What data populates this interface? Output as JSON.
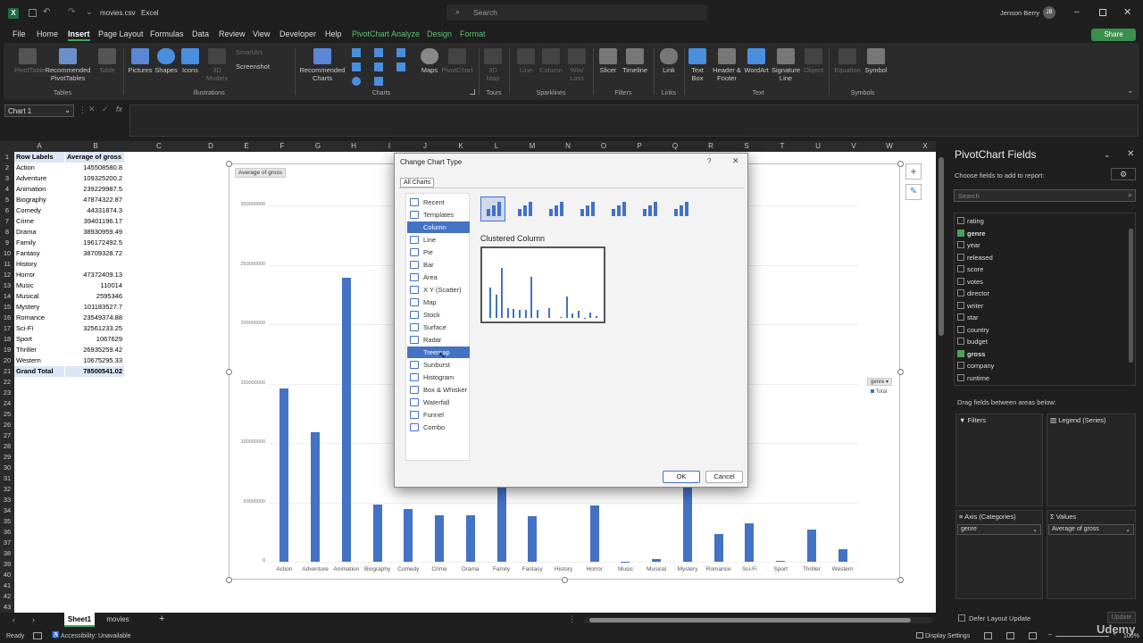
{
  "titlebar": {
    "filename": "movies.csv",
    "app": "Excel",
    "search_placeholder": "Search",
    "user": "Jenson Berry",
    "user_initials": "JB"
  },
  "menu": {
    "tabs": [
      "File",
      "Home",
      "Insert",
      "Page Layout",
      "Formulas",
      "Data",
      "Review",
      "View",
      "Developer",
      "Help"
    ],
    "ctx_tabs": [
      "PivotChart Analyze",
      "Design",
      "Format"
    ],
    "share": "Share"
  },
  "ribbon": {
    "groups": [
      "Tables",
      "Illustrations",
      "Charts",
      "Tours",
      "Sparklines",
      "Filters",
      "Links",
      "Text",
      "Symbols"
    ],
    "buttons": {
      "pivottable": "PivotTable",
      "recommended_pivot": "Recommended PivotTables",
      "table": "Table",
      "pictures": "Pictures",
      "shapes": "Shapes",
      "icons": "Icons",
      "models": "3D Models",
      "smartart": "SmartArt",
      "screenshot": "Screenshot",
      "recommended_charts": "Recommended Charts",
      "maps": "Maps",
      "pivotchart": "PivotChart",
      "map3d": "3D Map",
      "line": "Line",
      "column": "Column",
      "winloss": "Win/ Loss",
      "slicer": "Slicer",
      "timeline": "Timeline",
      "link": "Link",
      "textbox": "Text Box",
      "headerfooter": "Header & Footer",
      "wordart": "WordArt",
      "signature": "Signature Line",
      "object": "Object",
      "equation": "Equation",
      "symbol": "Symbol"
    }
  },
  "namebox": "Chart 1",
  "columns": [
    "A",
    "B",
    "C",
    "D",
    "E",
    "F",
    "G",
    "H",
    "I",
    "J",
    "K",
    "L",
    "M",
    "N",
    "O",
    "P",
    "Q",
    "R",
    "S",
    "T",
    "U",
    "V",
    "W",
    "X"
  ],
  "table": {
    "header": [
      "Row Labels",
      "Average of gross"
    ],
    "rows": [
      [
        "Action",
        "145508580.8"
      ],
      [
        "Adventure",
        "109325200.2"
      ],
      [
        "Animation",
        "239229987.5"
      ],
      [
        "Biography",
        "47874322.87"
      ],
      [
        "Comedy",
        "44331874.3"
      ],
      [
        "Crime",
        "39401196.17"
      ],
      [
        "Drama",
        "38930959.49"
      ],
      [
        "Family",
        "196172492.5"
      ],
      [
        "Fantasy",
        "38709328.72"
      ],
      [
        "History",
        ""
      ],
      [
        "Horror",
        "47372409.13"
      ],
      [
        "Music",
        "110014"
      ],
      [
        "Musical",
        "2595346"
      ],
      [
        "Mystery",
        "101183527.7"
      ],
      [
        "Romance",
        "23549374.88"
      ],
      [
        "Sci-Fi",
        "32561233.25"
      ],
      [
        "Sport",
        "1067629"
      ],
      [
        "Thriller",
        "26935259.42"
      ],
      [
        "Western",
        "10675295.33"
      ]
    ],
    "total": [
      "Grand Total",
      "78500541.02"
    ]
  },
  "chart_data": {
    "type": "bar",
    "title": "",
    "field_button": "Average of gross",
    "legend_field": "genre",
    "legend_entry": "Total",
    "categories": [
      "Action",
      "Adventure",
      "Animation",
      "Biography",
      "Comedy",
      "Crime",
      "Drama",
      "Family",
      "Fantasy",
      "History",
      "Horror",
      "Music",
      "Musical",
      "Mystery",
      "Romance",
      "Sci-Fi",
      "Sport",
      "Thriller",
      "Western"
    ],
    "series": [
      {
        "name": "Total",
        "values": [
          145508580.8,
          109325200.2,
          239229987.5,
          47874322.87,
          44331874.3,
          39401196.17,
          38930959.49,
          196172492.5,
          38709328.72,
          0,
          47372409.13,
          110014,
          2595346,
          101183527.7,
          23549374.88,
          32561233.25,
          1067629,
          26935259.42,
          10675295.33
        ]
      }
    ],
    "yticks": [
      "0",
      "50000000",
      "100000000",
      "150000000",
      "200000000",
      "250000000",
      "300000000"
    ],
    "ylim": [
      0,
      300000000
    ]
  },
  "dialog": {
    "title": "Change Chart Type",
    "tab": "All Charts",
    "types": [
      "Recent",
      "Templates",
      "Column",
      "Line",
      "Pie",
      "Bar",
      "Area",
      "X Y (Scatter)",
      "Map",
      "Stock",
      "Surface",
      "Radar",
      "Treemap",
      "Sunburst",
      "Histogram",
      "Box & Whisker",
      "Waterfall",
      "Funnel",
      "Combo"
    ],
    "subtype_title": "Clustered Column",
    "ok": "OK",
    "cancel": "Cancel"
  },
  "pivot": {
    "title": "PivotChart Fields",
    "subtitle": "Choose fields to add to report:",
    "search_placeholder": "Search",
    "fields": [
      {
        "name": "rating",
        "on": false
      },
      {
        "name": "genre",
        "on": true
      },
      {
        "name": "year",
        "on": false
      },
      {
        "name": "released",
        "on": false
      },
      {
        "name": "score",
        "on": false
      },
      {
        "name": "votes",
        "on": false
      },
      {
        "name": "director",
        "on": false
      },
      {
        "name": "writer",
        "on": false
      },
      {
        "name": "star",
        "on": false
      },
      {
        "name": "country",
        "on": false
      },
      {
        "name": "budget",
        "on": false
      },
      {
        "name": "gross",
        "on": true
      },
      {
        "name": "company",
        "on": false
      },
      {
        "name": "runtime",
        "on": false
      }
    ],
    "drag_label": "Drag fields between areas below:",
    "filters": "Filters",
    "legend": "Legend (Series)",
    "axis": "Axis (Categories)",
    "values": "Values",
    "axis_value": "genre",
    "values_value": "Average of gross",
    "defer": "Defer Layout Update",
    "update": "Update"
  },
  "sheets": [
    "Sheet1",
    "movies"
  ],
  "status": {
    "ready": "Ready",
    "accessibility": "Accessibility: Unavailable",
    "display": "Display Settings",
    "zoom": "100%"
  },
  "watermark": "Udemy"
}
